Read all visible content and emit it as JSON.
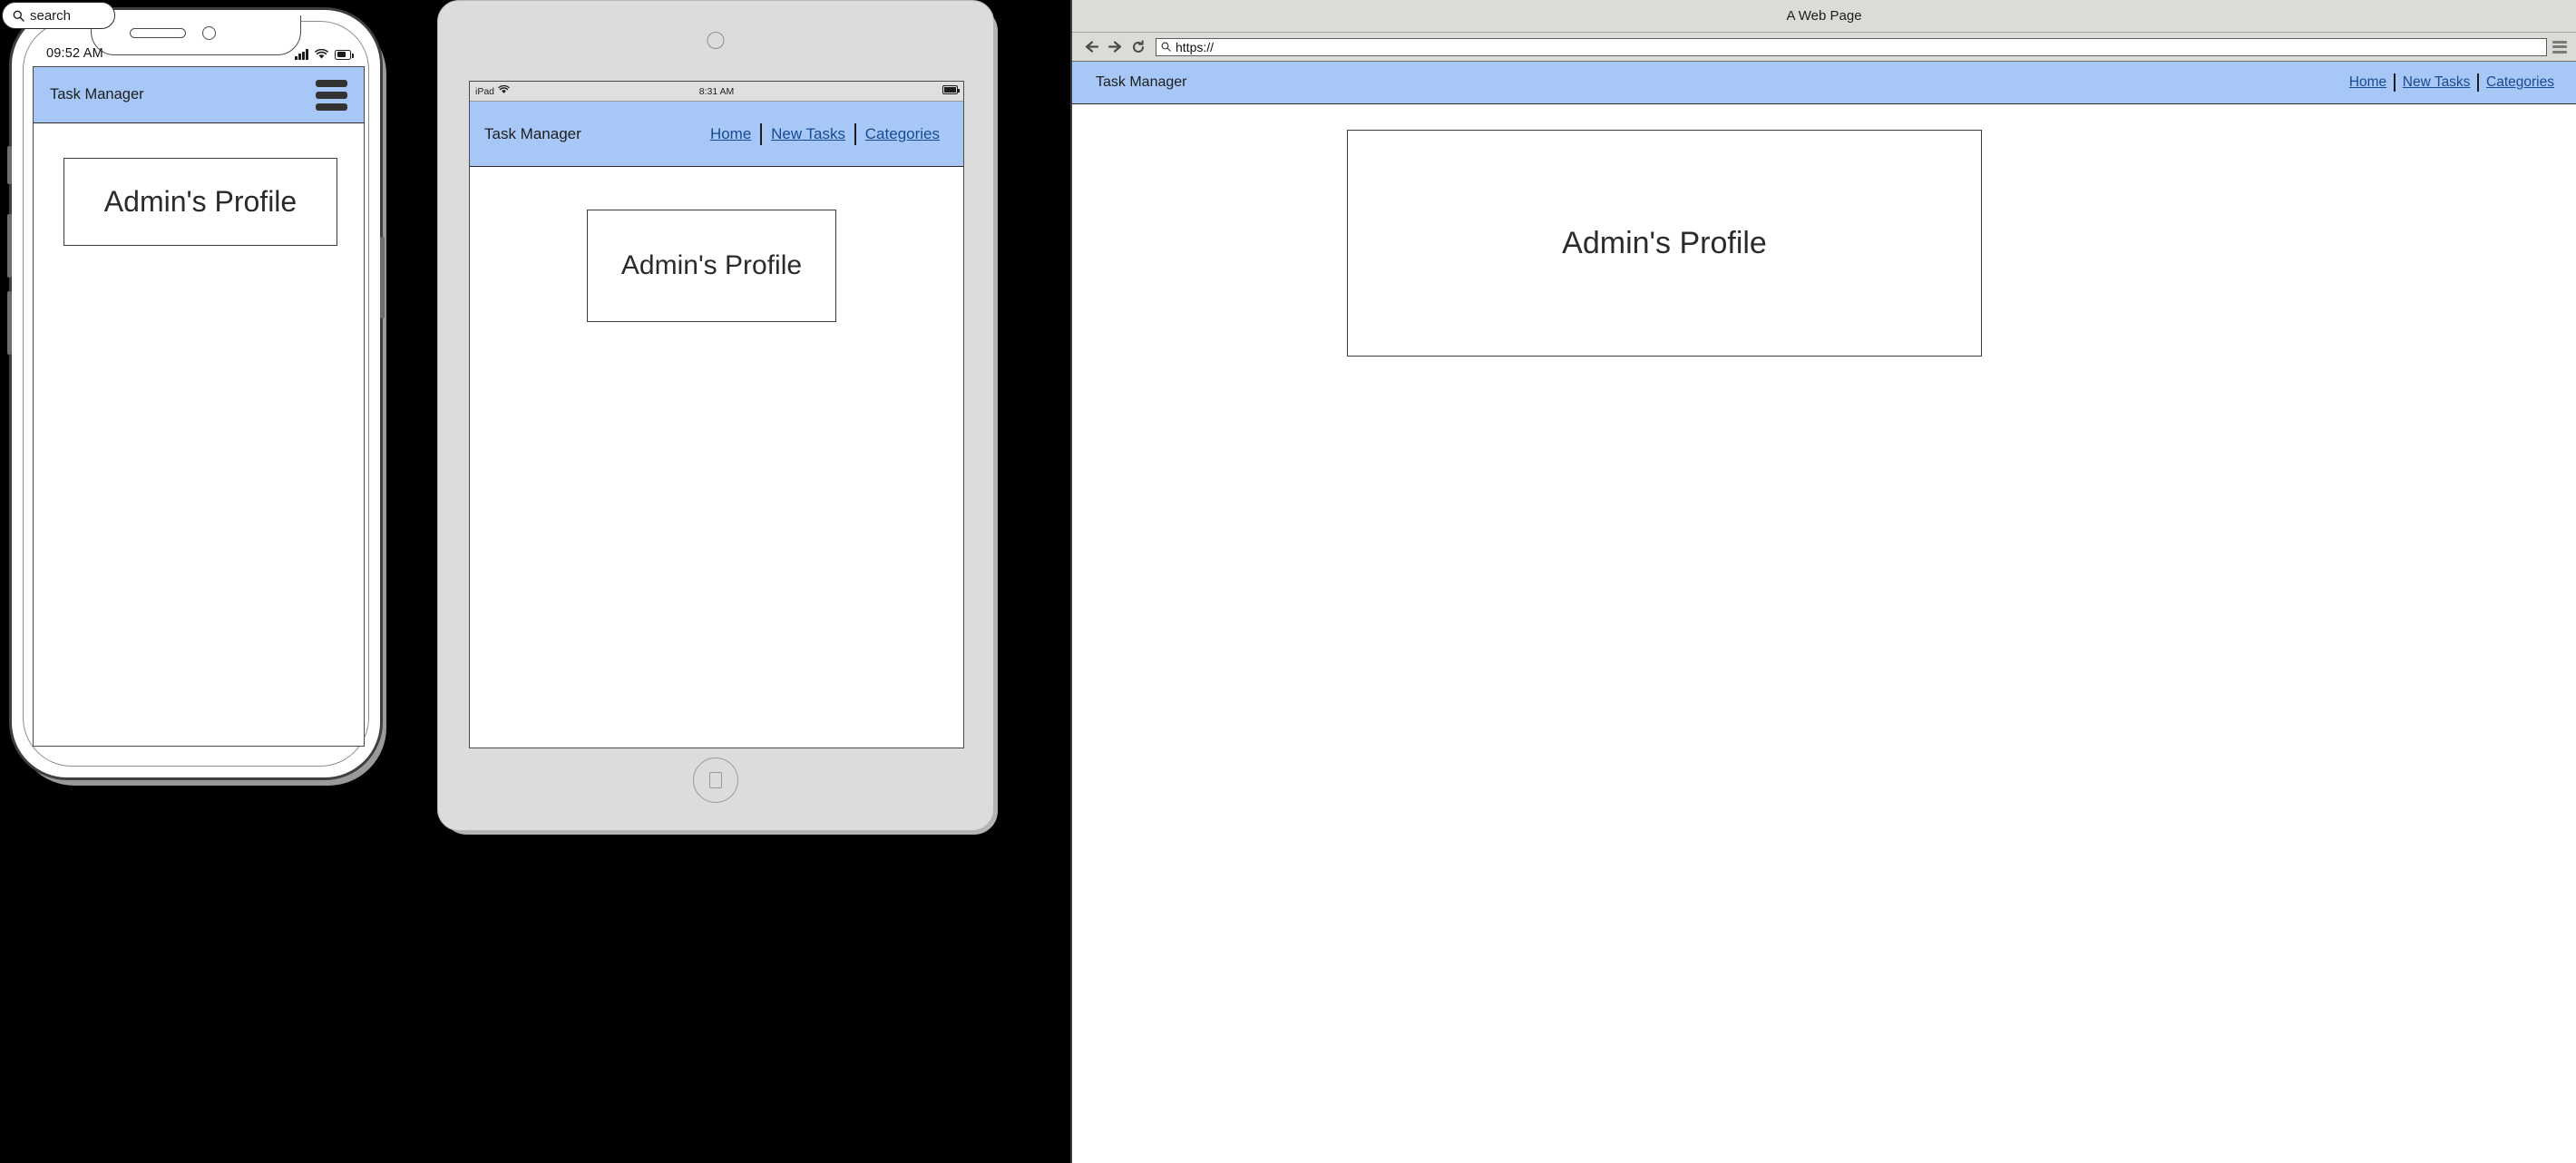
{
  "app": {
    "brand": "Task Manager",
    "nav_links": [
      "Home",
      "New Tasks",
      "Categories"
    ],
    "card_title": "Admin's Profile",
    "accent_color": "#a7c8f7",
    "link_color": "#164a91"
  },
  "overlay_search": {
    "label": "search",
    "icon": "search-icon"
  },
  "phone": {
    "status_time": "09:52 AM",
    "icons": [
      "signal-icon",
      "wifi-icon",
      "battery-icon"
    ],
    "appbar_title": "Task Manager",
    "menu_icon": "hamburger-menu-icon",
    "card_title": "Admin's Profile"
  },
  "tablet": {
    "device_label": "iPad",
    "status_time": "8:31 AM",
    "icons": [
      "wifi-icon",
      "battery-icon"
    ],
    "appbar_title": "Task Manager",
    "nav_links": [
      "Home",
      "New Tasks",
      "Categories"
    ],
    "card_title": "Admin's Profile",
    "home_button": "home-button"
  },
  "browser": {
    "window_title": "A Web Page",
    "url_value": "https://",
    "url_icon": "search-icon",
    "back_icon": "arrow-left-icon",
    "forward_icon": "arrow-right-icon",
    "reload_icon": "reload-icon",
    "menu_icon": "hamburger-menu-icon",
    "appbar_title": "Task Manager",
    "nav_links": [
      "Home",
      "New Tasks",
      "Categories"
    ],
    "card_title": "Admin's Profile"
  }
}
